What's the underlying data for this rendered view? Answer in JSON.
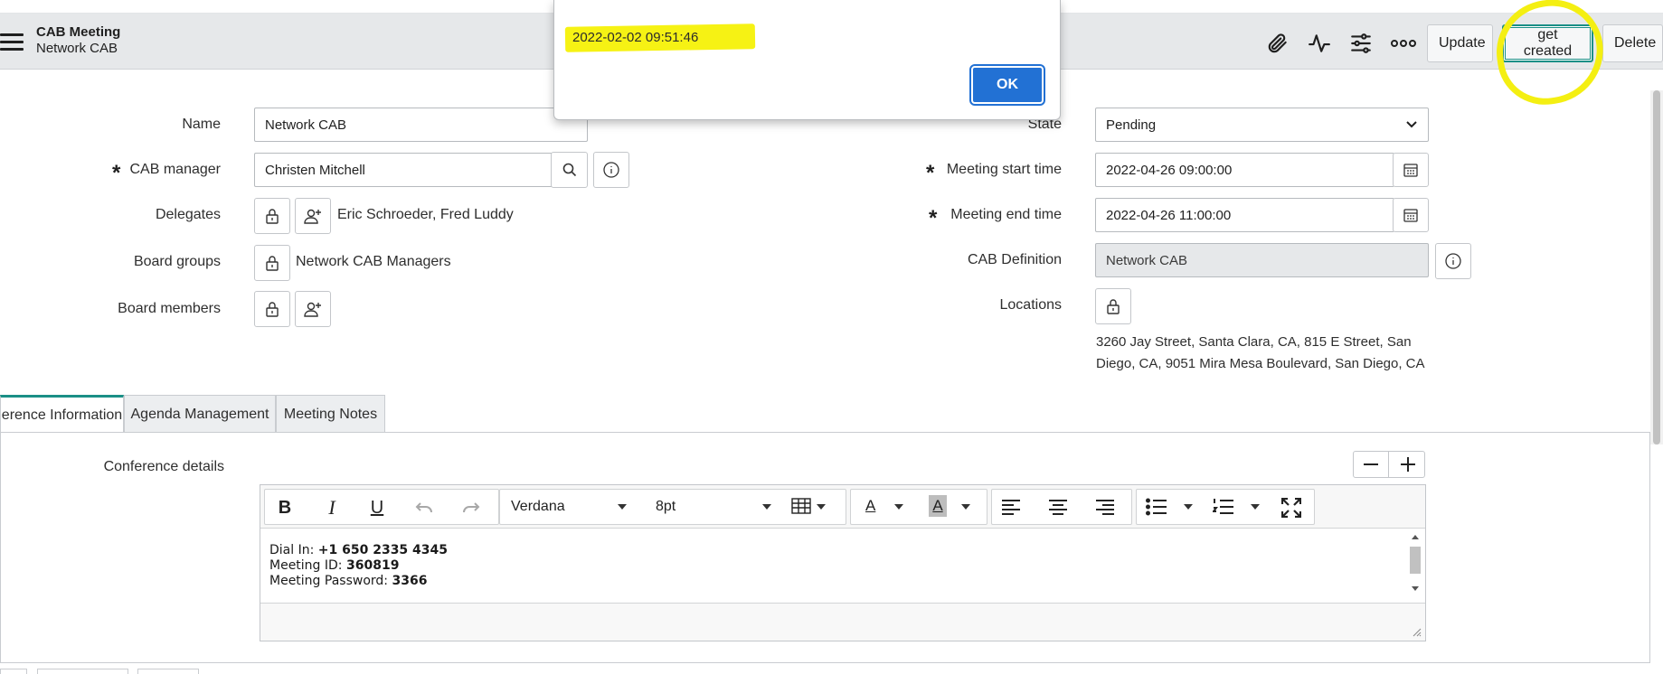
{
  "header": {
    "title": "CAB Meeting",
    "subtitle": "Network CAB",
    "buttons": {
      "update": "Update",
      "get_created": "get created",
      "delete": "Delete"
    },
    "icons": [
      "paperclip-icon",
      "activity-icon",
      "sliders-icon",
      "more-icon"
    ]
  },
  "dialog": {
    "message": "2022-02-02 09:51:46",
    "ok_label": "OK"
  },
  "form": {
    "name": {
      "label": "Name",
      "value": "Network CAB"
    },
    "cab_manager": {
      "label": "CAB manager",
      "value": "Christen Mitchell"
    },
    "delegates": {
      "label": "Delegates",
      "value": "Eric Schroeder, Fred Luddy"
    },
    "board_groups": {
      "label": "Board groups",
      "value": "Network CAB Managers"
    },
    "board_members": {
      "label": "Board members"
    },
    "state": {
      "label": "State",
      "value": "Pending"
    },
    "meeting_start": {
      "label": "Meeting start time",
      "value": "2022-04-26 09:00:00"
    },
    "meeting_end": {
      "label": "Meeting end time",
      "value": "2022-04-26 11:00:00"
    },
    "cab_definition": {
      "label": "CAB Definition",
      "value": "Network CAB"
    },
    "locations": {
      "label": "Locations",
      "line1": "3260 Jay Street, Santa Clara, CA, 815 E Street, San",
      "line2": "Diego, CA, 9051 Mira Mesa Boulevard, San Diego, CA"
    }
  },
  "tabs": [
    {
      "label": "erence Information"
    },
    {
      "label": "Agenda Management"
    },
    {
      "label": "Meeting Notes"
    }
  ],
  "conference": {
    "label": "Conference details",
    "font_family": "Verdana",
    "font_size": "8pt",
    "lines": [
      {
        "prefix": "Dial In: ",
        "value": "+1 650 2335 4345"
      },
      {
        "prefix": "Meeting ID: ",
        "value": "360819"
      },
      {
        "prefix": "Meeting Password: ",
        "value": "3366"
      }
    ]
  },
  "colors": {
    "highlight": "#f6f214",
    "accent": "#1a8f86",
    "ok": "#2271d4"
  }
}
